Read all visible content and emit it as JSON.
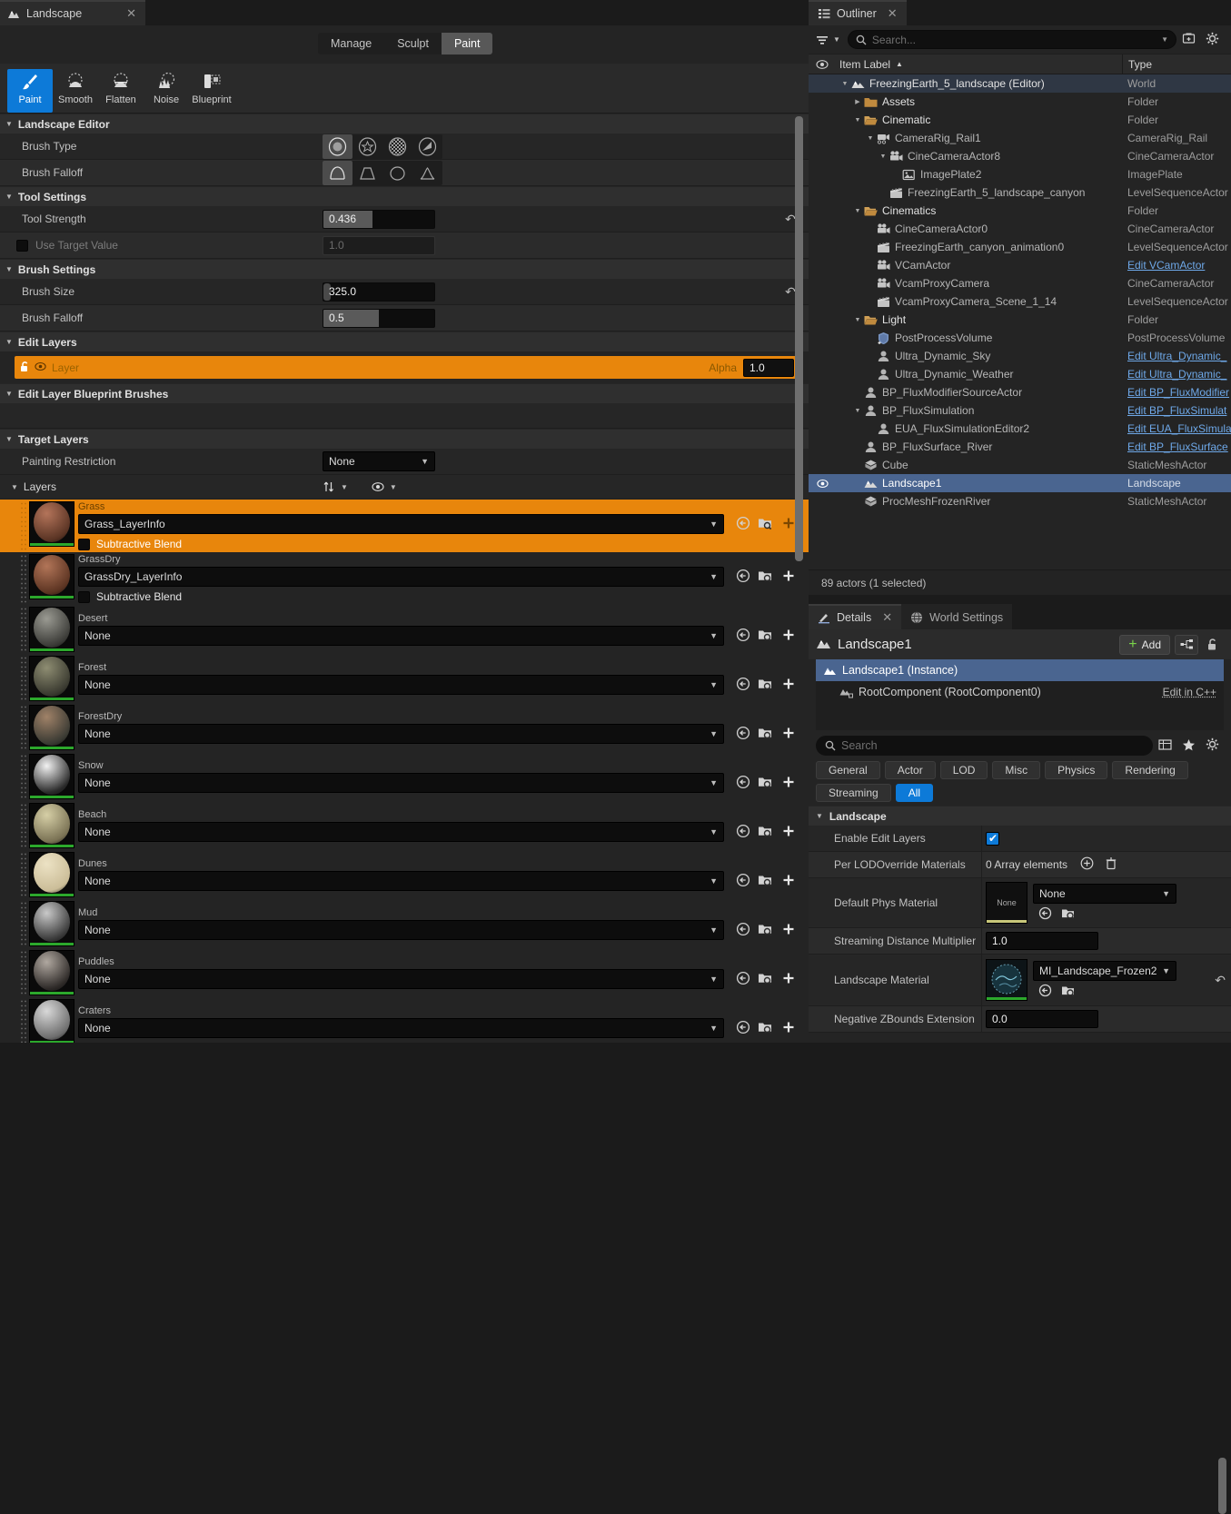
{
  "landscape": {
    "tab": {
      "label": "Landscape",
      "icon": "mountain-icon",
      "close": "✕"
    },
    "modes": [
      {
        "label": "Manage",
        "active": false
      },
      {
        "label": "Sculpt",
        "active": false
      },
      {
        "label": "Paint",
        "active": true
      }
    ],
    "tools": [
      {
        "label": "Paint",
        "icon": "brush-icon",
        "selected": true
      },
      {
        "label": "Smooth",
        "icon": "smooth-icon",
        "selected": false
      },
      {
        "label": "Flatten",
        "icon": "flatten-icon",
        "selected": false
      },
      {
        "label": "Noise",
        "icon": "noise-icon",
        "selected": false
      },
      {
        "label": "Blueprint",
        "icon": "blueprint-icon",
        "selected": false
      }
    ],
    "sections": {
      "landscape_editor": "Landscape Editor",
      "tool_settings": "Tool Settings",
      "brush_settings": "Brush Settings",
      "edit_layers": "Edit Layers",
      "edit_layer_bp_brushes": "Edit Layer Blueprint Brushes",
      "target_layers": "Target Layers"
    },
    "brush_type": {
      "label": "Brush Type",
      "selected_index": 0,
      "options": [
        "circle-brush-icon",
        "alpha-brush-icon",
        "pattern-brush-icon",
        "component-brush-icon"
      ]
    },
    "brush_falloff_shape": {
      "label": "Brush Falloff",
      "selected_index": 0,
      "options": [
        "smooth-falloff-icon",
        "linear-falloff-icon",
        "spherical-falloff-icon",
        "tip-falloff-icon"
      ]
    },
    "tool_strength": {
      "label": "Tool Strength",
      "value": "0.436",
      "fill_pct": 44
    },
    "use_target_value": {
      "label": "Use Target Value",
      "checked": false,
      "value": "1.0"
    },
    "brush_size": {
      "label": "Brush Size",
      "value": "325.0",
      "fill_pct": 2
    },
    "brush_falloff": {
      "label": "Brush Falloff",
      "value": "0.5",
      "fill_pct": 50
    },
    "edit_layer": {
      "name": "Layer",
      "alpha_label": "Alpha",
      "alpha_value": "1.0",
      "lock_icon": "unlock-icon",
      "visibility_icon": "eye-icon"
    },
    "painting_restriction": {
      "label": "Painting Restriction",
      "value": "None"
    },
    "layers_group": {
      "label": "Layers",
      "sort_icon": "sort-icon",
      "visibility_icon": "eye-icon"
    },
    "subtractive_blend_label": "Subtractive Blend",
    "layers": [
      {
        "name": "Grass",
        "layer_info": "Grass_LayerInfo",
        "selected": true,
        "subtractive": false,
        "show_blend": true,
        "c1": "#b4745a",
        "c2": "#5a3424"
      },
      {
        "name": "GrassDry",
        "layer_info": "GrassDry_LayerInfo",
        "selected": false,
        "subtractive": false,
        "show_blend": true,
        "c1": "#b27558",
        "c2": "#5c3422"
      },
      {
        "name": "Desert",
        "layer_info": "None",
        "selected": false,
        "show_blend": false,
        "c1": "#9a9a92",
        "c2": "#3c3c38"
      },
      {
        "name": "Forest",
        "layer_info": "None",
        "selected": false,
        "show_blend": false,
        "c1": "#8e8d72",
        "c2": "#3a3a30"
      },
      {
        "name": "ForestDry",
        "layer_info": "None",
        "selected": false,
        "show_blend": false,
        "c1": "#a08268",
        "c2": "#3a3a33"
      },
      {
        "name": "Snow",
        "layer_info": "None",
        "selected": false,
        "show_blend": false,
        "c1": "#f2f2f2",
        "c2": "#2a2a2a"
      },
      {
        "name": "Beach",
        "layer_info": "None",
        "selected": false,
        "show_blend": false,
        "c1": "#d6cfa6",
        "c2": "#7a7254"
      },
      {
        "name": "Dunes",
        "layer_info": "None",
        "selected": false,
        "show_blend": false,
        "c1": "#ece2c4",
        "c2": "#cbbd98"
      },
      {
        "name": "Mud",
        "layer_info": "None",
        "selected": false,
        "show_blend": false,
        "c1": "#c9c9c9",
        "c2": "#3a3a3a"
      },
      {
        "name": "Puddles",
        "layer_info": "None",
        "selected": false,
        "show_blend": false,
        "c1": "#b0a8a0",
        "c2": "#2e2a28"
      },
      {
        "name": "Craters",
        "layer_info": "None",
        "selected": false,
        "show_blend": false,
        "c1": "#d8d8d8",
        "c2": "#6e6e6e"
      }
    ]
  },
  "outliner": {
    "tab": {
      "label": "Outliner",
      "icon": "outliner-icon",
      "close": "✕"
    },
    "toolbar": {
      "filter_icon": "filter-icon",
      "filter_caret": "chevron-down-icon",
      "search_icon": "search-icon",
      "search_placeholder": "Search...",
      "search_caret": "chevron-down-icon",
      "add_icon": "add-folder-icon",
      "settings_icon": "gear-icon"
    },
    "columns": {
      "visibility_icon": "eye-icon",
      "item_label": "Item Label",
      "sort_arrow": "▲",
      "type": "Type"
    },
    "rows": [
      {
        "label": "FreezingEarth_5_landscape (Editor)",
        "type": "World",
        "indent": 1,
        "arrow": "down",
        "icon": "landscape-icon",
        "world": true,
        "bold": true
      },
      {
        "label": "Assets",
        "type": "Folder",
        "indent": 2,
        "arrow": "right",
        "icon": "folder-closed-icon",
        "bold": true
      },
      {
        "label": "Cinematic",
        "type": "Folder",
        "indent": 2,
        "arrow": "down",
        "icon": "folder-open-icon",
        "bold": true
      },
      {
        "label": "CameraRig_Rail1",
        "type": "CameraRig_Rail",
        "indent": 3,
        "arrow": "down",
        "icon": "camera-rig-icon"
      },
      {
        "label": "CineCameraActor8",
        "type": "CineCameraActor",
        "indent": 4,
        "arrow": "down",
        "icon": "cine-camera-icon"
      },
      {
        "label": "ImagePlate2",
        "type": "ImagePlate",
        "indent": 5,
        "arrow": "none",
        "icon": "image-plate-icon"
      },
      {
        "label": "FreezingEarth_5_landscape_canyon",
        "type": "LevelSequenceActor",
        "indent": 4,
        "arrow": "none",
        "icon": "clapperboard-icon"
      },
      {
        "label": "Cinematics",
        "type": "Folder",
        "indent": 2,
        "arrow": "down",
        "icon": "folder-open-icon",
        "bold": true
      },
      {
        "label": "CineCameraActor0",
        "type": "CineCameraActor",
        "indent": 3,
        "arrow": "none",
        "icon": "cine-camera-icon"
      },
      {
        "label": "FreezingEarth_canyon_animation0",
        "type": "LevelSequenceActor",
        "indent": 3,
        "arrow": "none",
        "icon": "clapperboard-icon"
      },
      {
        "label": "VCamActor",
        "type": "Edit VCamActor",
        "indent": 3,
        "arrow": "none",
        "icon": "cine-camera-icon",
        "link": true
      },
      {
        "label": "VcamProxyCamera",
        "type": "CineCameraActor",
        "indent": 3,
        "arrow": "none",
        "icon": "cine-camera-icon"
      },
      {
        "label": "VcamProxyCamera_Scene_1_14",
        "type": "LevelSequenceActor",
        "indent": 3,
        "arrow": "none",
        "icon": "clapperboard-icon"
      },
      {
        "label": "Light",
        "type": "Folder",
        "indent": 2,
        "arrow": "down",
        "icon": "folder-open-icon",
        "bold": true
      },
      {
        "label": "PostProcessVolume",
        "type": "PostProcessVolume",
        "indent": 3,
        "arrow": "none",
        "icon": "postprocess-icon"
      },
      {
        "label": "Ultra_Dynamic_Sky",
        "type": "Edit Ultra_Dynamic_",
        "indent": 3,
        "arrow": "none",
        "icon": "blueprint-actor-icon",
        "link": true
      },
      {
        "label": "Ultra_Dynamic_Weather",
        "type": "Edit Ultra_Dynamic_",
        "indent": 3,
        "arrow": "none",
        "icon": "blueprint-actor-icon",
        "link": true
      },
      {
        "label": "BP_FluxModifierSourceActor",
        "type": "Edit BP_FluxModifier",
        "indent": 2,
        "arrow": "none",
        "icon": "blueprint-actor-icon",
        "link": true
      },
      {
        "label": "BP_FluxSimulation",
        "type": "Edit BP_FluxSimulat",
        "indent": 2,
        "arrow": "down",
        "icon": "blueprint-actor-icon",
        "link": true
      },
      {
        "label": "EUA_FluxSimulationEditor2",
        "type": "Edit EUA_FluxSimula",
        "indent": 3,
        "arrow": "none",
        "icon": "blueprint-actor-icon",
        "link": true
      },
      {
        "label": "BP_FluxSurface_River",
        "type": "Edit BP_FluxSurface",
        "indent": 2,
        "arrow": "none",
        "icon": "blueprint-actor-icon",
        "link": true
      },
      {
        "label": "Cube",
        "type": "StaticMeshActor",
        "indent": 2,
        "arrow": "none",
        "icon": "static-mesh-icon"
      },
      {
        "label": "Landscape1",
        "type": "Landscape",
        "indent": 2,
        "arrow": "none",
        "icon": "landscape-icon",
        "selected": true,
        "eye": true
      },
      {
        "label": "ProcMeshFrozenRiver",
        "type": "StaticMeshActor",
        "indent": 2,
        "arrow": "none",
        "icon": "static-mesh-icon"
      }
    ],
    "status": "89 actors (1 selected)"
  },
  "details": {
    "tabs": [
      {
        "label": "Details",
        "icon": "details-icon",
        "active": true,
        "close": "✕"
      },
      {
        "label": "World Settings",
        "icon": "world-icon",
        "active": false
      }
    ],
    "title": "Landscape1",
    "title_icon": "landscape-icon",
    "add_button": {
      "label": "Add",
      "plus": "+"
    },
    "graph_button_icon": "component-graph-icon",
    "lock_button_icon": "unlock-icon",
    "components": [
      {
        "label": "Landscape1 (Instance)",
        "icon": "landscape-icon",
        "selected": true,
        "edit": ""
      },
      {
        "label": "RootComponent (RootComponent0)",
        "icon": "landscape-component-icon",
        "selected": false,
        "edit": "Edit in C++"
      }
    ],
    "search": {
      "placeholder": "Search",
      "icon": "search-icon"
    },
    "search_actions": [
      "grid-icon",
      "star-icon",
      "gear-icon"
    ],
    "filters": [
      {
        "label": "General",
        "on": false
      },
      {
        "label": "Actor",
        "on": false
      },
      {
        "label": "LOD",
        "on": false
      },
      {
        "label": "Misc",
        "on": false
      },
      {
        "label": "Physics",
        "on": false
      },
      {
        "label": "Rendering",
        "on": false
      },
      {
        "label": "Streaming",
        "on": false
      },
      {
        "label": "All",
        "on": true
      }
    ],
    "section": "Landscape",
    "properties": [
      {
        "label": "Enable Edit Layers",
        "type": "checkbox",
        "checked": true
      },
      {
        "label": "Per LODOverride Materials",
        "type": "array",
        "value": "0 Array elements",
        "add_icon": "plus-circle-icon",
        "delete_icon": "trash-icon"
      },
      {
        "label": "Default Phys Material",
        "type": "asset",
        "value": "None",
        "thumb_label": "None",
        "thumb_bar": "#c9c87a",
        "browse_icon": "browse-icon",
        "find_icon": "find-in-browser-icon"
      },
      {
        "label": "Streaming Distance Multiplier",
        "type": "number",
        "value": "1.0"
      },
      {
        "label": "Landscape Material",
        "type": "asset",
        "value": "MI_Landscape_Frozen2",
        "thumb_label": "",
        "thumb_bar": "#2ca82c",
        "browse_icon": "browse-icon",
        "find_icon": "find-in-browser-icon",
        "reset_icon": "reset-arrow-icon"
      },
      {
        "label": "Negative ZBounds Extension",
        "type": "number",
        "value": "0.0"
      }
    ]
  },
  "colors": {
    "accent_orange": "#e8860c",
    "accent_blue": "#0d7ad8",
    "selection_blue": "#4a6590",
    "link_blue": "#6ea8e8",
    "panel_bg": "#242424",
    "green_bar": "#2ca82c"
  }
}
